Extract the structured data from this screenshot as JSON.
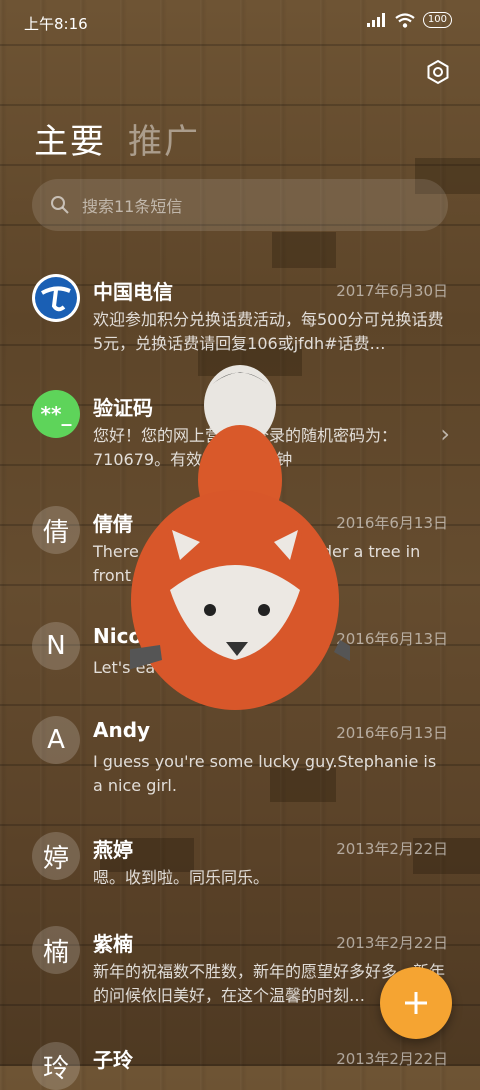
{
  "status_bar": {
    "time": "上午8:16",
    "battery": "100"
  },
  "tabs": [
    {
      "label": "主要"
    },
    {
      "label": "推广"
    }
  ],
  "search": {
    "placeholder": "搜索11条短信"
  },
  "conversations": [
    {
      "avatar": "",
      "avatar_icon": "china-telecom-logo-icon",
      "name": "中国电信",
      "date": "2017年6月30日",
      "message": "欢迎参加积分兑换话费活动，每500分可兑换话费5元，兑换话费请回复106或jfdh#话费…"
    },
    {
      "avatar": "**_",
      "avatar_color": "#5ed45a",
      "name": "验证码",
      "date": "",
      "message": "您好！您的网上营业厅登录的随机密码为：710679。有效时间为3分钟"
    },
    {
      "avatar": "倩",
      "name": "倩倩",
      "date": "2016年6月13日",
      "message": "There was a table set out under a tree in front of the hous"
    },
    {
      "avatar": "N",
      "name": "Nicole",
      "date": "2016年6月13日",
      "message": "Let's eat out,shall we?"
    },
    {
      "avatar": "A",
      "name": "Andy",
      "date": "2016年6月13日",
      "message": "I guess you're some lucky guy.Stephanie is a nice girl."
    },
    {
      "avatar": "婷",
      "name": "燕婷",
      "date": "2013年2月22日",
      "message": "嗯。收到啦。同乐同乐。"
    },
    {
      "avatar": "楠",
      "name": "紫楠",
      "date": "2013年2月22日",
      "message": "新年的祝福数不胜数，新年的愿望好多好多，新年的问候依旧美好，在这个温馨的时刻…"
    },
    {
      "avatar": "玲",
      "name": "子玲",
      "date": "2013年2月22日",
      "message": ""
    }
  ],
  "fab": {
    "label": "+",
    "color": "#f5a432"
  }
}
